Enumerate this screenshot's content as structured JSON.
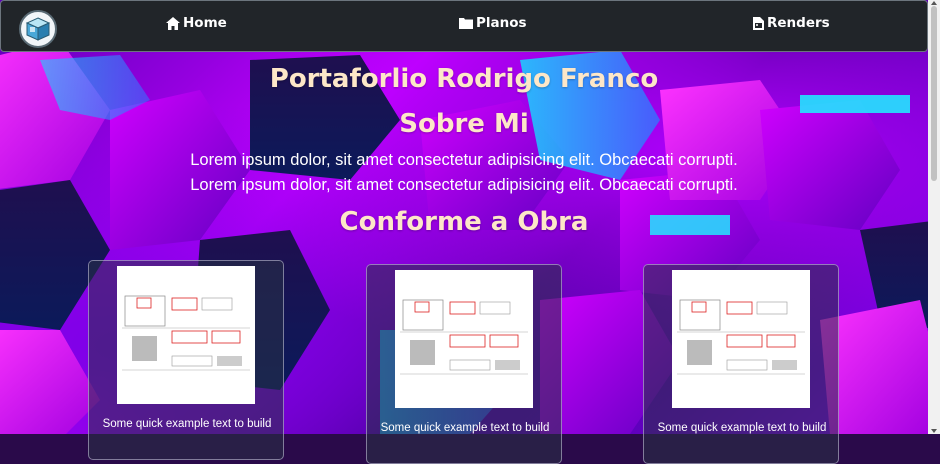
{
  "nav": {
    "home_label": "Home",
    "planos_label": "Planos",
    "renders_label": "Renders"
  },
  "hero": {
    "title": "Portaforlio Rodrigo Franco",
    "about_heading": "Sobre Mi",
    "about_lines": [
      "Lorem ipsum dolor, sit amet consectetur adipisicing elit. Obcaecati corrupti.",
      "Lorem ipsum dolor, sit amet consectetur adipisicing elit. Obcaecati corrupti."
    ],
    "section_heading": "Conforme a Obra"
  },
  "cards": [
    {
      "text": "Some quick example text to build"
    },
    {
      "text": "Some quick example text to build"
    },
    {
      "text": "Some quick example text to build"
    }
  ],
  "colors": {
    "navbar": "#212529",
    "title": "#fde7c8",
    "background_accent": "#c400ff",
    "cyan_glow": "#22e6ff"
  }
}
